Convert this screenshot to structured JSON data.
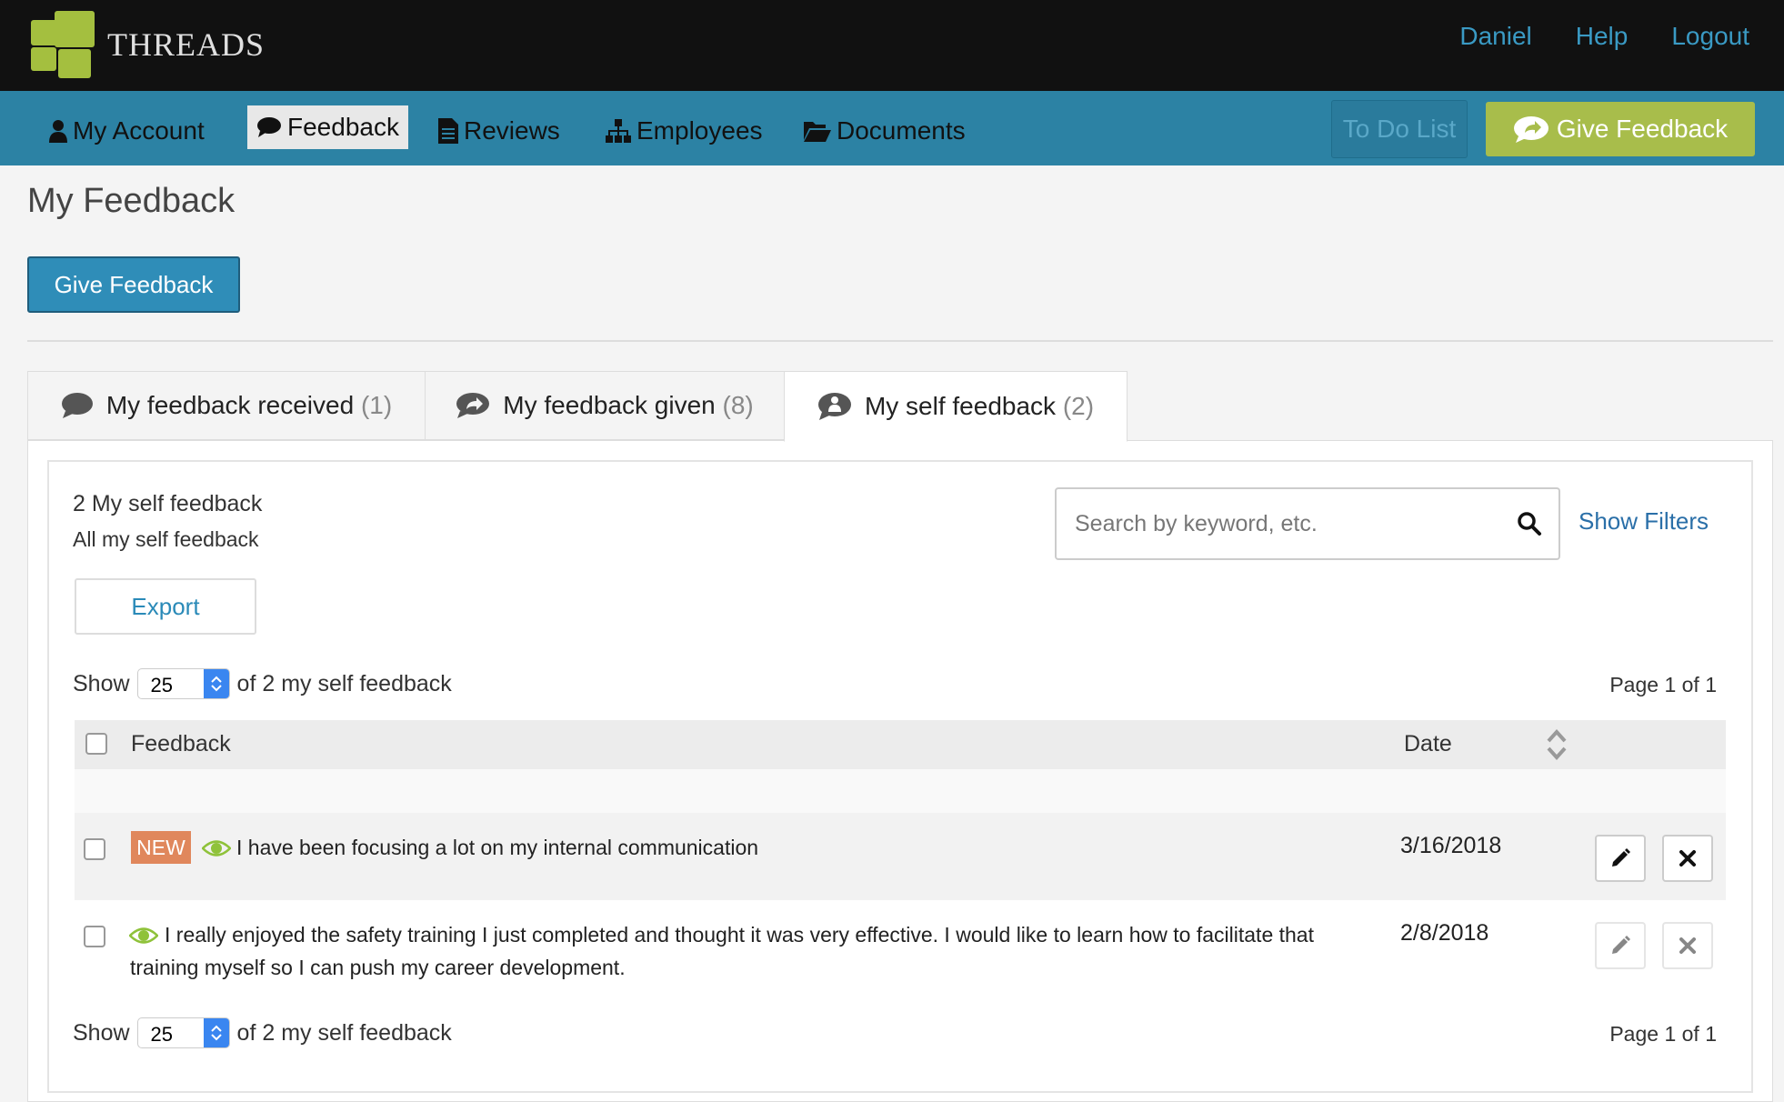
{
  "app": {
    "brand": "THREADS",
    "top_links": [
      "Daniel",
      "Help",
      "Logout"
    ]
  },
  "nav": {
    "items": [
      {
        "label": "My Account",
        "icon": "user-icon"
      },
      {
        "label": "Feedback",
        "icon": "comment-icon"
      },
      {
        "label": "Reviews",
        "icon": "document-icon"
      },
      {
        "label": "Employees",
        "icon": "org-chart-icon"
      },
      {
        "label": "Documents",
        "icon": "folder-open-icon"
      }
    ],
    "active": "Feedback",
    "todo_label": "To Do List",
    "give_feedback_label": "Give Feedback"
  },
  "page": {
    "title": "My Feedback",
    "give_feedback_button": "Give Feedback"
  },
  "tabs": [
    {
      "label": "My feedback received",
      "count": "(1)",
      "icon": "comment-icon"
    },
    {
      "label": "My feedback given",
      "count": "(8)",
      "icon": "share-comment-icon"
    },
    {
      "label": "My self feedback",
      "count": "(2)",
      "icon": "self-comment-icon"
    }
  ],
  "active_tab": "My self feedback",
  "summary": {
    "title": "2 My self feedback",
    "subtitle": "All my self feedback",
    "export_label": "Export"
  },
  "search": {
    "placeholder": "Search by keyword, etc.",
    "value": "",
    "show_filters": "Show Filters"
  },
  "pagination": {
    "show_label": "Show",
    "page_size": "25",
    "of_label": "of 2 my self feedback",
    "page_label": "Page 1 of 1"
  },
  "table": {
    "columns": [
      "Feedback",
      "Date"
    ],
    "rows": [
      {
        "new_badge": "NEW",
        "text": "I have been focusing a lot on my internal communication",
        "date": "3/16/2018"
      },
      {
        "new_badge": "",
        "text_line1": "I really enjoyed the safety training I just completed and thought it was very effective. I would like to learn how to facilitate that",
        "text_line2": "training myself so I can push my career development.",
        "date": "2/8/2018"
      }
    ]
  },
  "colors": {
    "topbar": "#111111",
    "navbar": "#2c82a4",
    "accent_green": "#a8bd4b",
    "primary_blue": "#2f8db8",
    "new_badge": "#e0875c",
    "eye_icon": "#8fc23a"
  }
}
